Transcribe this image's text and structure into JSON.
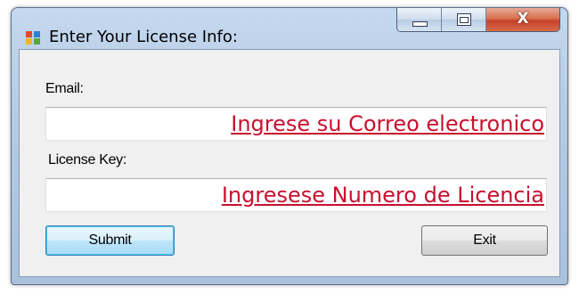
{
  "window": {
    "title": "Enter Your License Info:",
    "icon": "app-window-icon"
  },
  "caption_buttons": {
    "minimize_icon": "minimize-icon",
    "maximize_icon": "maximize-icon",
    "close_glyph": "X"
  },
  "form": {
    "email_label": "Email:",
    "email_value": "Ingrese su Correo electronico",
    "license_label": "License Key:",
    "license_value": "Ingresese Numero de Licencia",
    "submit_label": "Submit",
    "exit_label": "Exit"
  },
  "colors": {
    "annotation_text": "#c8102e",
    "default_button_border": "#3c7fb1"
  }
}
